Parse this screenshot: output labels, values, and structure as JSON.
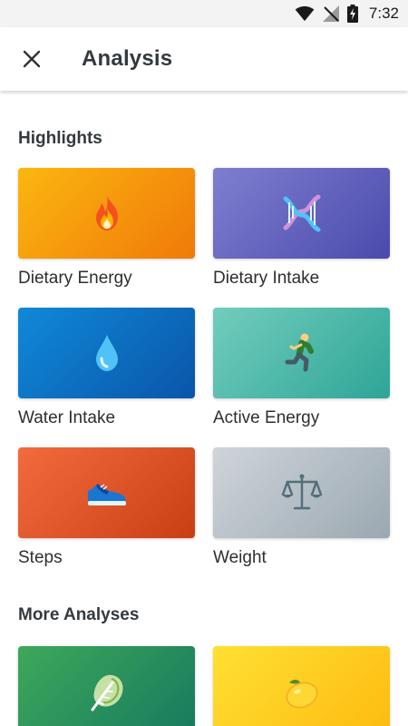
{
  "status_bar": {
    "time": "7:32"
  },
  "app_bar": {
    "title": "Analysis"
  },
  "highlights": {
    "heading": "Highlights",
    "tiles": [
      {
        "label": "Dietary Energy",
        "icon": "fire-icon",
        "gradient": [
          "#fbb70f",
          "#f0790a"
        ]
      },
      {
        "label": "Dietary Intake",
        "icon": "dna-icon",
        "gradient": [
          "#7f7fd0",
          "#4a4aad"
        ]
      },
      {
        "label": "Water Intake",
        "icon": "water-drop-icon",
        "gradient": [
          "#1089d8",
          "#0a55a9"
        ]
      },
      {
        "label": "Active Energy",
        "icon": "runner-icon",
        "gradient": [
          "#72cdbd",
          "#2ea597"
        ]
      },
      {
        "label": "Steps",
        "icon": "sneaker-icon",
        "gradient": [
          "#f26b3d",
          "#c93f14"
        ]
      },
      {
        "label": "Weight",
        "icon": "scales-icon",
        "gradient": [
          "#cfd5da",
          "#9ba8b1"
        ]
      }
    ]
  },
  "more": {
    "heading": "More Analyses",
    "tiles": [
      {
        "icon": "leafy-green-icon",
        "gradient": [
          "#3ea85a",
          "#17795f"
        ]
      },
      {
        "icon": "lemon-icon",
        "gradient": [
          "#ffe033",
          "#fdbb10"
        ]
      }
    ]
  }
}
